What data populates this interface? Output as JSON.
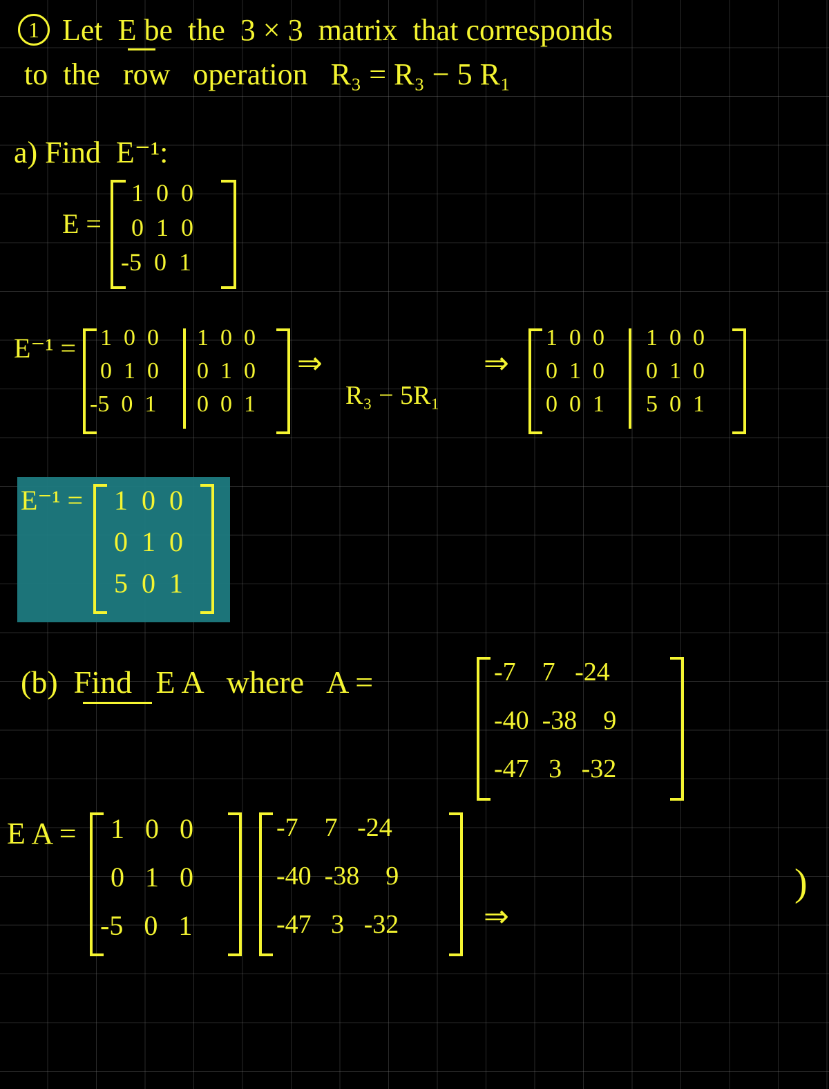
{
  "problem": {
    "number": "1",
    "intro_line1": "Let  E be  the  3 × 3  matrix  that corresponds",
    "intro_line2": "to  the   row   operation   R₃ = R₃ − 5 R₁"
  },
  "part_a": {
    "label": "a) Find  E⁻¹:",
    "E_label": "E =",
    "E_rows": [
      "1  0  0",
      "0  1  0",
      "-5  0  1"
    ],
    "inv_label": "E⁻¹ =",
    "aug_left_rows": [
      "1  0  0",
      "0  1  0",
      "-5  0  1"
    ],
    "aug_right_rows": [
      "1  0  0",
      "0  1  0",
      "0  0  1"
    ],
    "op_note": "R₃ − 5R₁",
    "aug2_left_rows": [
      "1  0  0",
      "0  1  0",
      "0  0  1"
    ],
    "aug2_right_rows": [
      "1  0  0",
      "0  1  0",
      "5  0  1"
    ],
    "result_label": "E⁻¹ =",
    "result_rows": [
      "1  0  0",
      "0  1  0",
      "5  0  1"
    ]
  },
  "part_b": {
    "label": "(b)  Find   E A   where   A =",
    "A_rows": [
      "-7    7   -24",
      "-40  -38    9",
      "-47   3   -32"
    ],
    "EA_label": "E A =",
    "E_rows": [
      "1   0   0",
      "0   1   0",
      "-5   0   1"
    ],
    "A2_rows": [
      "-7    7   -24",
      "-40  -38    9",
      "-47   3   -32"
    ],
    "arrow": "⇒",
    "stray": ")"
  }
}
